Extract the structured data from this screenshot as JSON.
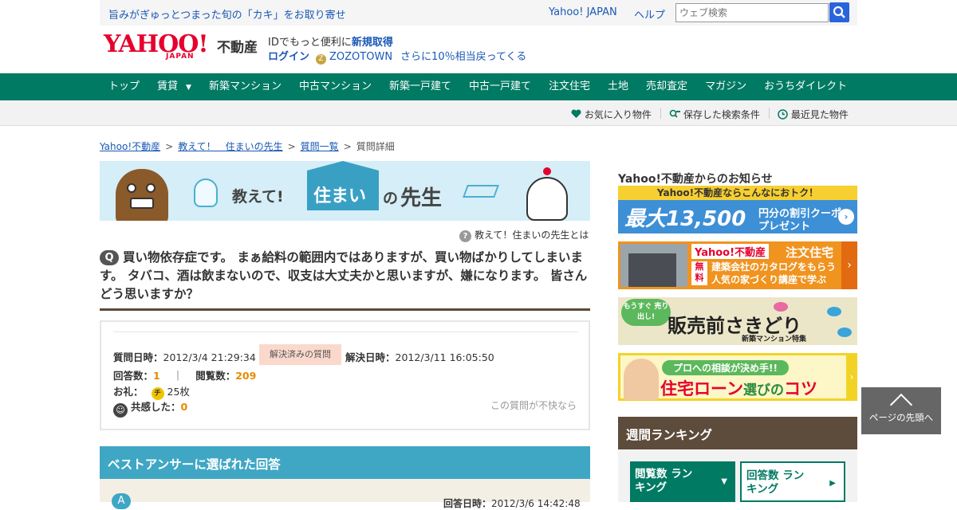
{
  "topbar": {
    "promo": "旨みがぎゅっとつまった旬の「カキ」をお取り寄せ",
    "yahoo_japan": "Yahoo! JAPAN",
    "help": "ヘルプ",
    "search_placeholder": "ウェブ検索"
  },
  "logo": {
    "yahoo": "YAHOO!",
    "japan": "JAPAN",
    "fudosan": "不動産"
  },
  "account": {
    "line1": "IDでもっと便利に",
    "register": "新規取得",
    "login": "ログイン",
    "zozo_icon": "Z",
    "zozotown": "ZOZOTOWN",
    "cashback": "さらに10％相当戻ってくる"
  },
  "nav": {
    "items": [
      "トップ",
      "賃貸",
      "新築マンション",
      "中古マンション",
      "新築一戸建て",
      "中古一戸建て",
      "注文住宅",
      "土地",
      "売却査定",
      "マガジン",
      "おうちダイレクト"
    ],
    "caret": "▼"
  },
  "subnav": {
    "favorites": "お気に入り物件",
    "saved_search": "保存した検索条件",
    "recent": "最近見た物件"
  },
  "breadcrumb": {
    "items": [
      "Yahoo!不動産",
      "教えて！　住まいの先生",
      "質問一覧",
      "質問詳細"
    ],
    "sep": ">"
  },
  "banner": {
    "oshiete": "教えて!",
    "sumai": "住まい",
    "no": "の",
    "sensei": "先生"
  },
  "what_is": "教えて！住まいの先生とは",
  "what_is_icon": "?",
  "question": {
    "icon": "Q",
    "text": "買い物依存症です。 まぁ給料の範囲内ではありますが、買い物ばかりしてしまいます。 タバコ、酒は飲まないので、収支は大丈夫かと思いますが、嫌になります。 皆さんどう思いますか？"
  },
  "info": {
    "asked_label": "質問日時：",
    "asked_at": "2012/3/4 21:29:34",
    "status": "解決済みの質問",
    "resolved_label": "解決日時：",
    "resolved_at": "2012/3/11 16:05:50",
    "answers_label": "回答数：",
    "answers": "1",
    "divider": "｜",
    "views_label": "閲覧数：",
    "views": "209",
    "reward_label": "お礼：",
    "chip": "チ",
    "reward": "25枚",
    "empathy_icon": "☺",
    "empathy_label": "共感した：",
    "empathy": "0",
    "report": "この質問が不快なら"
  },
  "best_answer": {
    "title": "ベストアンサーに選ばれた回答",
    "icon": "A",
    "answered_label": "回答日時：",
    "answered_at": "2012/3/6 14:42:48"
  },
  "sidebar": {
    "notice_title": "Yahoo!不動産からのお知らせ",
    "ad1": {
      "band": "Yahoo!不動産ならこんなにおトク！",
      "big": "最大13,500",
      "sub1": "円分の割引クーポン",
      "sub2": "プレゼント",
      "go": "›"
    },
    "ad2": {
      "brand": "Yahoo!不動産",
      "type": "注文住宅",
      "free": "無料",
      "line1": "建築会社のカタログをもらう",
      "line2": "人気の家づくり講座で学ぶ",
      "arrow": "›"
    },
    "ad3": {
      "bubble": "もうすぐ 売り出し!",
      "main": "販売前さきどり",
      "sub": "新築マンション特集"
    },
    "ad4": {
      "pill": "プロへの相談が決め手!!",
      "main1": "住宅ローン",
      "main2": "選びの",
      "main3": "コツ",
      "arrow": "›"
    },
    "ranking_title": "週間ランキング",
    "tab1": "閲覧数 ランキング",
    "tab1_tri": "▼",
    "tab2": "回答数 ランキング",
    "tab2_tri": "▶"
  },
  "back_to_top": "ページの先頭へ",
  "colors": {
    "nav_green": "#007a63",
    "link_blue": "#1a58b6",
    "yahoo_red": "#e6002d",
    "best_answer_blue": "#3fa7c4",
    "ranking_brown": "#5d4b3b"
  }
}
